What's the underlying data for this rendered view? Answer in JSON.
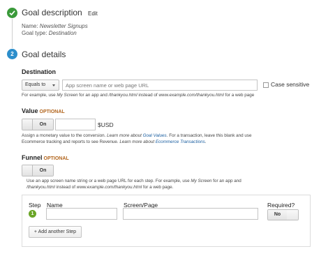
{
  "goal_description": {
    "title": "Goal description",
    "edit_label": "Edit",
    "name_label": "Name:",
    "name_value": "Newsletter Signups",
    "type_label": "Goal type:",
    "type_value": "Destination"
  },
  "goal_details": {
    "step_number": "2",
    "title": "Goal details"
  },
  "destination": {
    "label": "Destination",
    "match_type": "Equals to",
    "placeholder": "App screen name or web page URL",
    "case_sensitive_label": "Case sensitive",
    "case_sensitive_checked": false,
    "help": {
      "t1": "For example, use ",
      "e1": "My Screen",
      "t2": " for an app and ",
      "e2": "/thankyou.html",
      "t3": " instead of ",
      "e3": "www.example.com/thankyou.html",
      "t4": " for a web page"
    }
  },
  "value": {
    "label": "Value",
    "optional": "OPTIONAL",
    "toggle": "On",
    "amount": "",
    "currency": "$USD",
    "help": {
      "t1": "Assign a monetary value to the conversion. ",
      "e1": "Learn more about ",
      "l1": "Goal Values",
      "t2": ". For a transaction, leave this blank and use",
      "t3": "Ecommerce tracking and reports to see Revenue. ",
      "e2": "Learn more about ",
      "l2": "Ecommerce Transactions",
      "t4": "."
    }
  },
  "funnel": {
    "label": "Funnel",
    "optional": "OPTIONAL",
    "toggle": "On",
    "help": {
      "t1": "Use an app screen name string or a web page URL for each step. For example, use ",
      "e1": "My Screen",
      "t2": " for an app and",
      "e2": "/thankyou.html",
      "t3": " instead of ",
      "e3": "www.example.com/thankyou.html",
      "t4": " for a web page."
    },
    "columns": {
      "step": "Step",
      "name": "Name",
      "screen": "Screen/Page",
      "required": "Required?"
    },
    "rows": [
      {
        "step": "1",
        "name": "",
        "screen": "",
        "required": "No"
      }
    ],
    "add_step_label": "+ Add another Step"
  },
  "colors": {
    "complete_green": "#3a9a3a",
    "step_blue": "#2c8ecb",
    "optional_orange": "#b2651d",
    "link_blue": "#1a5ea0",
    "funnel_step_green": "#6aa527"
  }
}
